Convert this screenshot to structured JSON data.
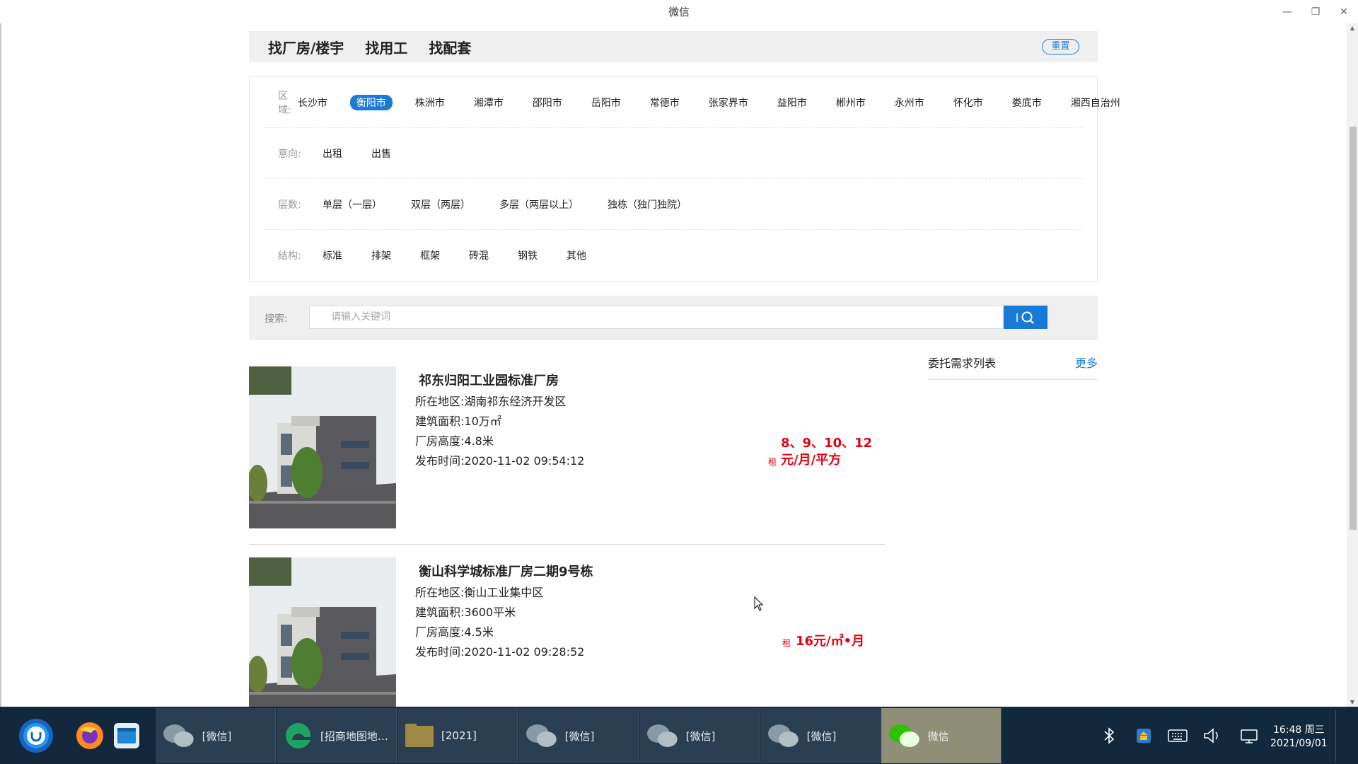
{
  "window": {
    "title": "微信",
    "controls": [
      "—",
      "❐",
      "✕"
    ]
  },
  "topnav": {
    "tabs": [
      "找厂房/楼宇",
      "找用工",
      "找配套"
    ],
    "reset_label": "重置"
  },
  "filters": {
    "region": {
      "label": "区域:",
      "options": [
        "长沙市",
        "衡阳市",
        "株洲市",
        "湘潭市",
        "邵阳市",
        "岳阳市",
        "常德市",
        "张家界市",
        "益阳市",
        "郴州市",
        "永州市",
        "怀化市",
        "娄底市",
        "湘西自治州"
      ],
      "selected": "衡阳市"
    },
    "intent": {
      "label": "意向:",
      "options": [
        "出租",
        "出售"
      ]
    },
    "floors": {
      "label": "层数:",
      "options": [
        "单层（一层）",
        "双层（两层）",
        "多层（两层以上）",
        "独栋（独门独院）"
      ]
    },
    "structure": {
      "label": "结构:",
      "options": [
        "标准",
        "排架",
        "框架",
        "砖混",
        "钢铁",
        "其他"
      ]
    }
  },
  "search": {
    "label": "搜索:",
    "placeholder": "请输入关键词"
  },
  "listings": [
    {
      "name": "祁东归阳工业园标准厂房",
      "location": "所在地区:湖南祁东经济开发区",
      "area": "建筑面积:10万㎡",
      "height": "厂房高度:4.8米",
      "published": "发布时间:2020-11-02 09:54:12",
      "rent_tag": "租",
      "price_line1": "8、9、10、12",
      "price_line2": "元/月/平方"
    },
    {
      "name": "衡山科学城标准厂房二期9号栋",
      "location": "所在地区:衡山工业集中区",
      "area": "建筑面积:3600平米",
      "height": "厂房高度:4.5米",
      "published": "发布时间:2020-11-02 09:28:52",
      "rent_tag": "租",
      "price_line1": "16元/㎡•月"
    }
  ],
  "side": {
    "title": "委托需求列表",
    "more": "更多"
  },
  "taskbar": {
    "tasks": [
      "[微信]",
      "[招商地图地…",
      "[2021]",
      "[微信]",
      "[微信]",
      "[微信]",
      "微信"
    ],
    "time": "16:48 周三",
    "date": "2021/09/01"
  },
  "colors": {
    "accent": "#1a7ad8",
    "price": "#e60012",
    "taskbar": "#12283c"
  }
}
